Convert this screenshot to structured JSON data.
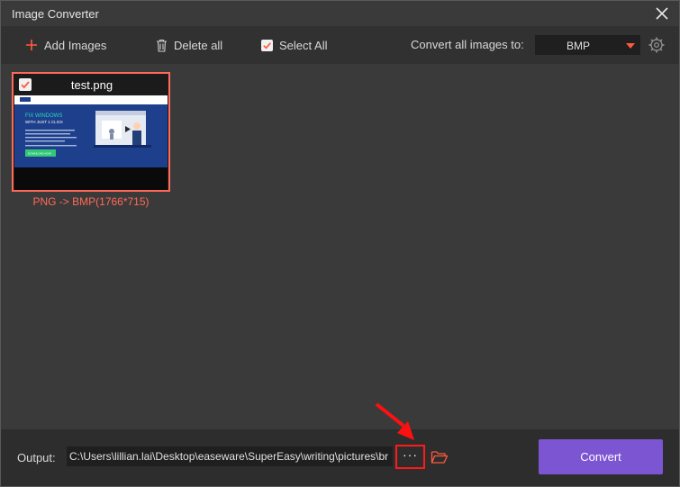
{
  "window": {
    "title": "Image Converter"
  },
  "toolbar": {
    "add_images_label": "Add Images",
    "delete_all_label": "Delete all",
    "select_all_label": "Select All",
    "select_all_checked": true,
    "convert_all_label": "Convert all images to:",
    "format_value": "BMP"
  },
  "files": [
    {
      "name": "test.png",
      "checked": true,
      "caption": "PNG -> BMP(1766*715)",
      "thumbnail": {
        "heading_line1": "FIX WINDOWS",
        "heading_line2": "WITH JUST 1 CLICK",
        "button_text": "DOWNLOAD NOW"
      }
    }
  ],
  "output": {
    "label": "Output:",
    "path": "C:\\Users\\lillian.lai\\Desktop\\easeware\\SuperEasy\\writing\\pictures\\br",
    "browse_label": "···"
  },
  "convert_button_label": "Convert",
  "colors": {
    "accent": "#ff6a58",
    "convert_button": "#7c55d3",
    "highlight": "#ff1a1a"
  },
  "icons": [
    "close-icon",
    "plus-icon",
    "trash-icon",
    "checkbox-checked-icon",
    "chevron-down-icon",
    "gear-icon",
    "folder-icon",
    "annotation-arrow-icon"
  ]
}
